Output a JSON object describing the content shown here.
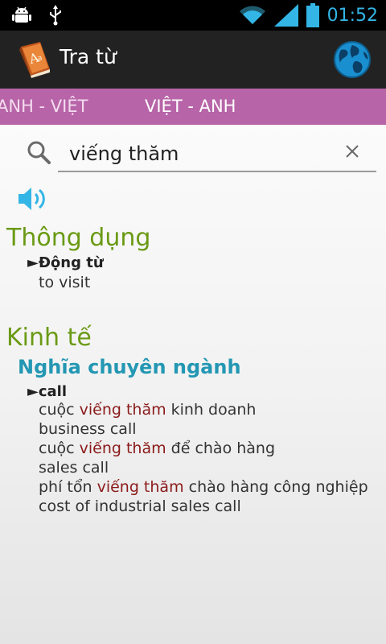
{
  "status_bar": {
    "time": "01:52",
    "icons": [
      "android-icon",
      "usb-icon",
      "wifi-icon",
      "signal-icon",
      "battery-icon"
    ]
  },
  "action_bar": {
    "title": "Tra từ",
    "app_icon": "dictionary-book-icon",
    "action_icon": "globe-icon"
  },
  "tabs": [
    {
      "label": "ANH - VIỆT",
      "selected": false
    },
    {
      "label": "VIỆT - ANH",
      "selected": true
    }
  ],
  "search": {
    "value": "viếng thăm"
  },
  "entries": {
    "common": {
      "heading": "Thông dụng",
      "pos": "Động từ",
      "meaning": "to visit"
    },
    "economics": {
      "heading": "Kinh tế",
      "subheading": "Nghĩa chuyên ngành",
      "pos": "call",
      "examples": [
        {
          "pre": "cuộc ",
          "keyword": "viếng thăm",
          "post": " kinh doanh",
          "translation": "business call"
        },
        {
          "pre": "cuộc ",
          "keyword": "viếng thăm",
          "post": " để chào hàng",
          "translation": "sales call"
        },
        {
          "pre": "phí tổn ",
          "keyword": "viếng thăm",
          "post": " chào hàng công nghiệp",
          "translation": "cost of industrial sales call"
        }
      ]
    }
  },
  "colors": {
    "tab_bar": "#b765a8",
    "category_heading": "#6a9a14",
    "subheading": "#2397b3",
    "keyword_highlight": "#8b1a1a",
    "clock": "#33b5e5"
  }
}
